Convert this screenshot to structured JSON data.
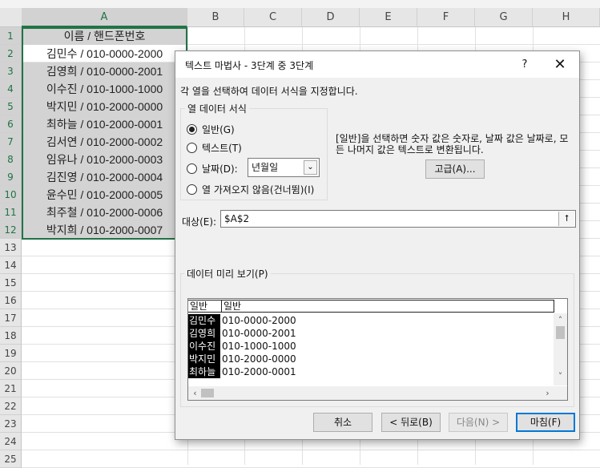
{
  "sheet": {
    "column_headers": [
      "A",
      "B",
      "C",
      "D",
      "E",
      "F",
      "G",
      "H"
    ],
    "row_numbers": [
      "1",
      "2",
      "3",
      "4",
      "5",
      "6",
      "7",
      "8",
      "9",
      "10",
      "11",
      "12",
      "13",
      "14",
      "15",
      "16",
      "17",
      "18",
      "19",
      "20",
      "21",
      "22",
      "23",
      "24",
      "25"
    ],
    "cells_A": [
      "이름 / 핸드폰번호",
      "김민수 / 010-0000-2000",
      "김영희 / 010-0000-2001",
      "이수진 / 010-1000-1000",
      "박지민 / 010-2000-0000",
      "최하늘 / 010-2000-0001",
      "김서연 / 010-2000-0002",
      "임유나 / 010-2000-0003",
      "김진영 / 010-2000-0004",
      "윤수민 / 010-2000-0005",
      "최주철 / 010-2000-0006",
      "박지희 / 010-2000-0007"
    ]
  },
  "dialog": {
    "title": "텍스트 마법사 - 3단계 중 3단계",
    "help_label": "?",
    "close_label": "✕",
    "instruction": "각 열을 선택하여 데이터 서식을 지정합니다.",
    "column_format_group": "열 데이터 서식",
    "radio_general": "일반(G)",
    "radio_text": "텍스트(T)",
    "radio_date": "날짜(D):",
    "radio_skip": "열 가져오지 않음(건너뜀)(I)",
    "date_format_value": "년월일",
    "description": "[일반]을 선택하면 숫자 값은 숫자로, 날짜 값은 날짜로, 모든 나머지 값은 텍스트로 변환됩니다.",
    "advanced_button": "고급(A)...",
    "target_label": "대상(E):",
    "target_value": "$A$2",
    "collapse_icon": "⭡",
    "preview_group": "데이터 미리 보기(P)",
    "preview_headers": [
      "일반",
      "일반"
    ],
    "preview_rows": [
      {
        "name": "김민수",
        "phone": "010-0000-2000"
      },
      {
        "name": "김영희",
        "phone": "010-0000-2001"
      },
      {
        "name": "이수진",
        "phone": "010-1000-1000"
      },
      {
        "name": "박지민",
        "phone": "010-2000-0000"
      },
      {
        "name": "최하늘",
        "phone": "010-2000-0001"
      }
    ],
    "buttons": {
      "cancel": "취소",
      "back": "< 뒤로(B)",
      "next": "다음(N) >",
      "finish": "마침(F)"
    }
  },
  "colors": {
    "accent_green": "#217346",
    "focus_blue": "#0078d7",
    "cell_shade": "#d3d3d3"
  }
}
